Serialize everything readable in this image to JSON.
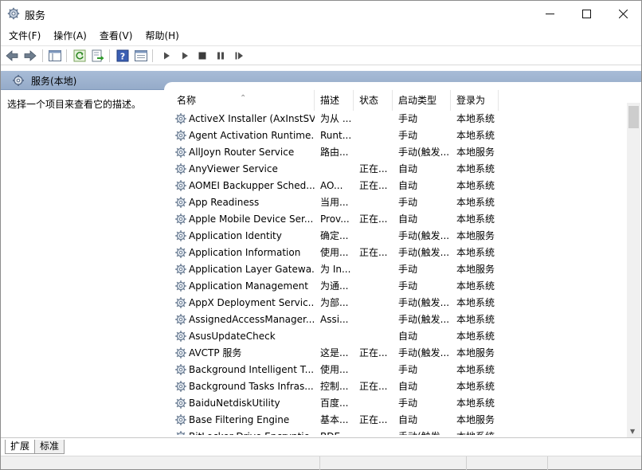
{
  "window": {
    "title": "服务",
    "icon": "services-gear-icon",
    "controls": {
      "minimize": "—",
      "maximize": "☐",
      "close": "✕"
    }
  },
  "menu": [
    "文件(F)",
    "操作(A)",
    "查看(V)",
    "帮助(H)"
  ],
  "toolbar": {
    "icons": [
      "back-arrow-icon",
      "forward-arrow-icon",
      "show-console-tree-icon",
      "refresh-icon",
      "export-list-icon",
      "help-icon",
      "properties-icon",
      "start-service-icon",
      "start-service-alt-icon",
      "stop-service-icon",
      "pause-service-icon",
      "resume-service-icon"
    ]
  },
  "tree": {
    "node_label": "服务(本地)"
  },
  "description_pane": {
    "text": "选择一个项目来查看它的描述。"
  },
  "columns": {
    "name": "名称",
    "desc": "描述",
    "status": "状态",
    "start": "启动类型",
    "logon": "登录为"
  },
  "services": [
    {
      "name": "ActiveX Installer (AxInstSV)",
      "desc": "为从 ...",
      "status": "",
      "start": "手动",
      "logon": "本地系统"
    },
    {
      "name": "Agent Activation Runtime...",
      "desc": "Runt...",
      "status": "",
      "start": "手动",
      "logon": "本地系统"
    },
    {
      "name": "AllJoyn Router Service",
      "desc": "路由...",
      "status": "",
      "start": "手动(触发...",
      "logon": "本地服务"
    },
    {
      "name": "AnyViewer Service",
      "desc": "",
      "status": "正在...",
      "start": "自动",
      "logon": "本地系统"
    },
    {
      "name": "AOMEI Backupper Sched...",
      "desc": "AO...",
      "status": "正在...",
      "start": "自动",
      "logon": "本地系统"
    },
    {
      "name": "App Readiness",
      "desc": "当用...",
      "status": "",
      "start": "手动",
      "logon": "本地系统"
    },
    {
      "name": "Apple Mobile Device Ser...",
      "desc": "Prov...",
      "status": "正在...",
      "start": "自动",
      "logon": "本地系统"
    },
    {
      "name": "Application Identity",
      "desc": "确定...",
      "status": "",
      "start": "手动(触发...",
      "logon": "本地服务"
    },
    {
      "name": "Application Information",
      "desc": "使用...",
      "status": "正在...",
      "start": "手动(触发...",
      "logon": "本地系统"
    },
    {
      "name": "Application Layer Gatewa...",
      "desc": "为 In...",
      "status": "",
      "start": "手动",
      "logon": "本地服务"
    },
    {
      "name": "Application Management",
      "desc": "为通...",
      "status": "",
      "start": "手动",
      "logon": "本地系统"
    },
    {
      "name": "AppX Deployment Servic...",
      "desc": "为部...",
      "status": "",
      "start": "手动(触发...",
      "logon": "本地系统"
    },
    {
      "name": "AssignedAccessManager...",
      "desc": "Assi...",
      "status": "",
      "start": "手动(触发...",
      "logon": "本地系统"
    },
    {
      "name": "AsusUpdateCheck",
      "desc": "",
      "status": "",
      "start": "自动",
      "logon": "本地系统"
    },
    {
      "name": "AVCTP 服务",
      "desc": "这是...",
      "status": "正在...",
      "start": "手动(触发...",
      "logon": "本地服务"
    },
    {
      "name": "Background Intelligent T...",
      "desc": "使用...",
      "status": "",
      "start": "手动",
      "logon": "本地系统"
    },
    {
      "name": "Background Tasks Infras...",
      "desc": "控制...",
      "status": "正在...",
      "start": "自动",
      "logon": "本地系统"
    },
    {
      "name": "BaiduNetdiskUtility",
      "desc": "百度...",
      "status": "",
      "start": "手动",
      "logon": "本地系统"
    },
    {
      "name": "Base Filtering Engine",
      "desc": "基本...",
      "status": "正在...",
      "start": "自动",
      "logon": "本地服务"
    },
    {
      "name": "BitLocker Drive Encryptio...",
      "desc": "BDE...",
      "status": "",
      "start": "手动(触发...",
      "logon": "本地系统"
    }
  ],
  "tabs": [
    "扩展",
    "标准"
  ]
}
